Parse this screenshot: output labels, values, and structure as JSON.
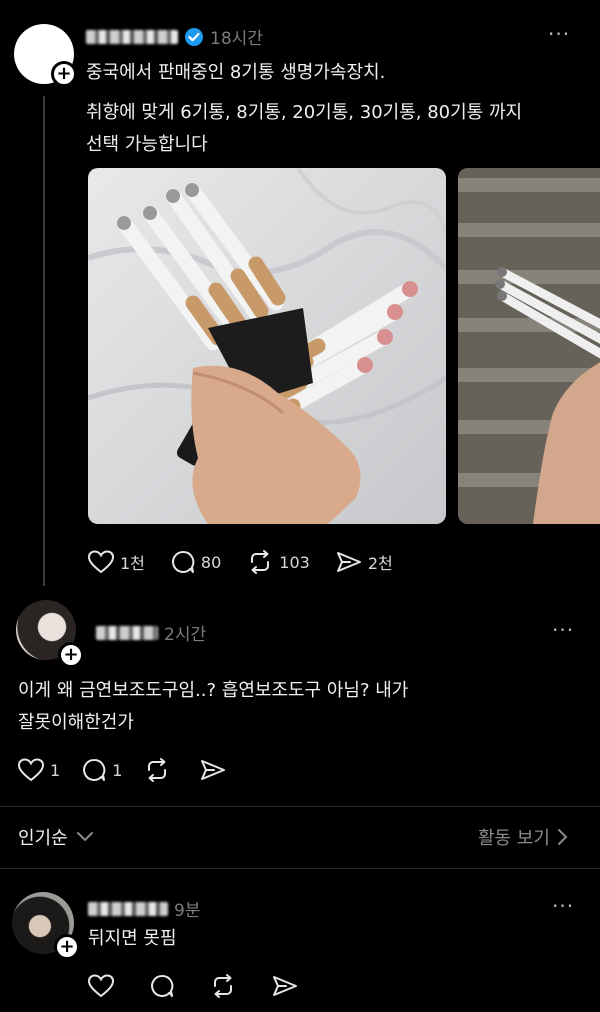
{
  "post": {
    "username_hidden": "blurred",
    "verified": true,
    "time": "18시간",
    "more": "···",
    "line1": "중국에서 판매중인 8기통 생명가속장치.",
    "line2": "취향에 맞게 6기통, 8기통, 20기통, 30기통, 80기통 까지",
    "line3": "선택 가능합니다",
    "actions": {
      "likes": "1천",
      "comments": "80",
      "reposts": "103",
      "shares": "2천"
    }
  },
  "reply1": {
    "time": "2시간",
    "more": "···",
    "line1": "이게 왜 금연보조도구임..? 흡연보조도구 아님? 내가",
    "line2": "잘못이해한건가",
    "actions": {
      "likes": "1",
      "comments": "1"
    }
  },
  "sort_bar": {
    "sort_label": "인기순",
    "activity_label": "활동 보기"
  },
  "reply2": {
    "time": "9분",
    "more": "···",
    "text": "뒤지면 못핌"
  },
  "colors": {
    "background": "#000000",
    "verified": "#1d9bf0",
    "muted": "#7b7b7b"
  }
}
